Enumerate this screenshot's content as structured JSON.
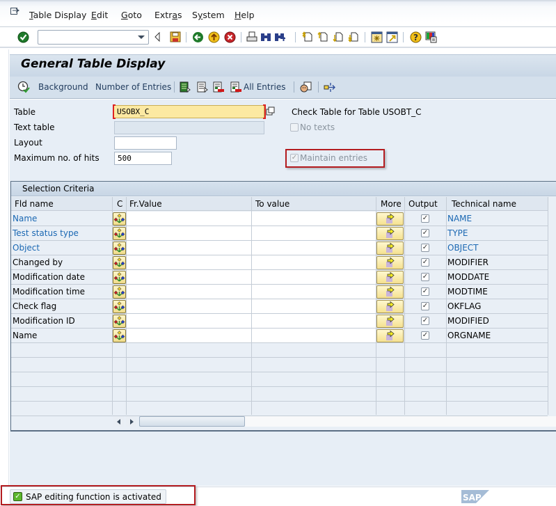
{
  "menu": {
    "items": [
      {
        "label": "Table Display",
        "mnemonic": "T"
      },
      {
        "label": "Edit",
        "mnemonic": "E"
      },
      {
        "label": "Goto",
        "mnemonic": "G"
      },
      {
        "label": "Extras",
        "mnemonic": "a"
      },
      {
        "label": "System",
        "mnemonic": "y"
      },
      {
        "label": "Help",
        "mnemonic": "H"
      }
    ]
  },
  "toolbar": {
    "command_field_value": "",
    "icons": [
      "enter-icon",
      "command-dropdown",
      "collapse-icon",
      "save-icon",
      "back-icon",
      "exit-icon",
      "cancel-icon",
      "print-icon",
      "find-icon",
      "find-next-icon",
      "first-page-icon",
      "previous-page-icon",
      "next-page-icon",
      "last-page-icon",
      "create-session-icon",
      "generate-shortcut-icon",
      "help-icon",
      "customize-layout-icon"
    ]
  },
  "page": {
    "title": "General Table Display"
  },
  "app_toolbar": {
    "background_label": "Background",
    "number_of_entries_label": "Number of Entries",
    "all_entries_label": "All Entries"
  },
  "form": {
    "table_label": "Table",
    "table_value": "USOBX_C",
    "text_table_label": "Text table",
    "text_table_value": "",
    "layout_label": "Layout",
    "layout_value": "",
    "max_hits_label": "Maximum no. of hits",
    "max_hits_value": "500",
    "check_table_text": "Check Table for Table USOBT_C",
    "no_texts_label": "No texts",
    "no_texts_checked": false,
    "maintain_entries_label": "Maintain entries",
    "maintain_entries_checked": true
  },
  "selection": {
    "title": "Selection Criteria",
    "columns": {
      "fld_name": "Fld name",
      "c": "C",
      "fr_value": "Fr.Value",
      "to_value": "To value",
      "more": "More",
      "output": "Output",
      "technical_name": "Technical name"
    },
    "rows": [
      {
        "name": "Name",
        "technical": "NAME",
        "key": true,
        "output": true,
        "from": "",
        "to": ""
      },
      {
        "name": "Test status type",
        "technical": "TYPE",
        "key": true,
        "output": true,
        "from": "",
        "to": ""
      },
      {
        "name": "Object",
        "technical": "OBJECT",
        "key": true,
        "output": true,
        "from": "",
        "to": ""
      },
      {
        "name": "Changed by",
        "technical": "MODIFIER",
        "key": false,
        "output": true,
        "from": "",
        "to": ""
      },
      {
        "name": "Modification date",
        "technical": "MODDATE",
        "key": false,
        "output": true,
        "from": "",
        "to": ""
      },
      {
        "name": "Modification time",
        "technical": "MODTIME",
        "key": false,
        "output": true,
        "from": "",
        "to": ""
      },
      {
        "name": "Check flag",
        "technical": "OKFLAG",
        "key": false,
        "output": true,
        "from": "",
        "to": ""
      },
      {
        "name": "Modification ID",
        "technical": "MODIFIED",
        "key": false,
        "output": true,
        "from": "",
        "to": ""
      },
      {
        "name": "Name",
        "technical": "ORGNAME",
        "key": false,
        "output": true,
        "from": "",
        "to": ""
      }
    ]
  },
  "status": {
    "message": "SAP editing function is activated",
    "type": "success"
  },
  "colors": {
    "link": "#1b68b3",
    "highlight_border": "#b41b1f",
    "focus_field": "#fce9a2"
  }
}
